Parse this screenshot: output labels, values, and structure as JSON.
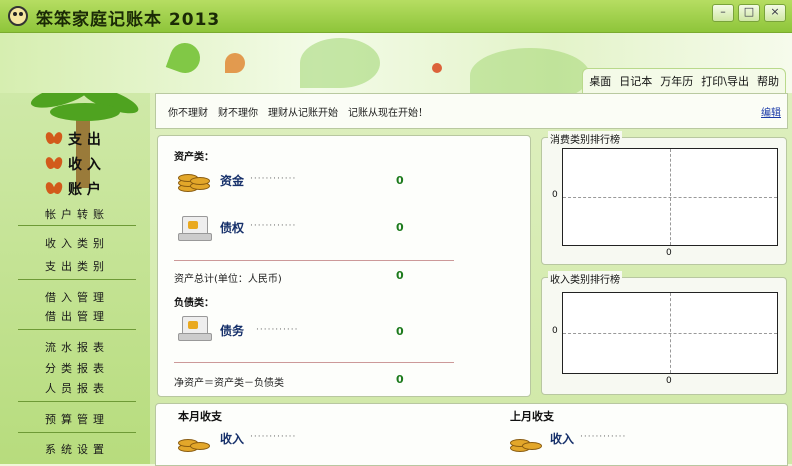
{
  "window": {
    "title": "笨笨家庭记账本 2013",
    "min": "–",
    "max": "□",
    "close": "×"
  },
  "top_menu": [
    "桌面",
    "日记本",
    "万年历",
    "打印\\导出",
    "帮助"
  ],
  "sidebar": {
    "main": [
      "支 出",
      "收 入",
      "账 户"
    ],
    "groups": [
      [
        "帐户转账"
      ],
      [
        "收入类别",
        "支出类别"
      ],
      [
        "借入管理",
        "借出管理"
      ],
      [
        "流水报表",
        "分类报表",
        "人员报表"
      ],
      [
        "预算管理"
      ],
      [
        "系统设置"
      ]
    ]
  },
  "notice": {
    "text": "你不理财　财不理你　理财从记账开始　记账从现在开始！",
    "edit": "编辑"
  },
  "assets": {
    "heading": "资产类：",
    "items": [
      {
        "label": "资金",
        "dots": "············",
        "value": "0"
      },
      {
        "label": "债权",
        "dots": "············",
        "value": "0"
      }
    ],
    "total_label": "资产总计(单位：人民币)",
    "total_value": "0"
  },
  "liabilities": {
    "heading": "负债类：",
    "items": [
      {
        "label": "债务",
        "dots": "···········",
        "value": "0"
      }
    ]
  },
  "net": {
    "label": "净资产＝资产类－负债类",
    "value": "0"
  },
  "rank_expense": {
    "title": "消费类别排行榜",
    "y_tick": "0",
    "x_tick": "0"
  },
  "rank_income": {
    "title": "收入类别排行榜",
    "y_tick": "0",
    "x_tick": "0"
  },
  "this_month": {
    "title": "本月收支",
    "label": "收入",
    "dots": "············"
  },
  "last_month": {
    "title": "上月收支",
    "label": "收入",
    "dots": "············"
  }
}
